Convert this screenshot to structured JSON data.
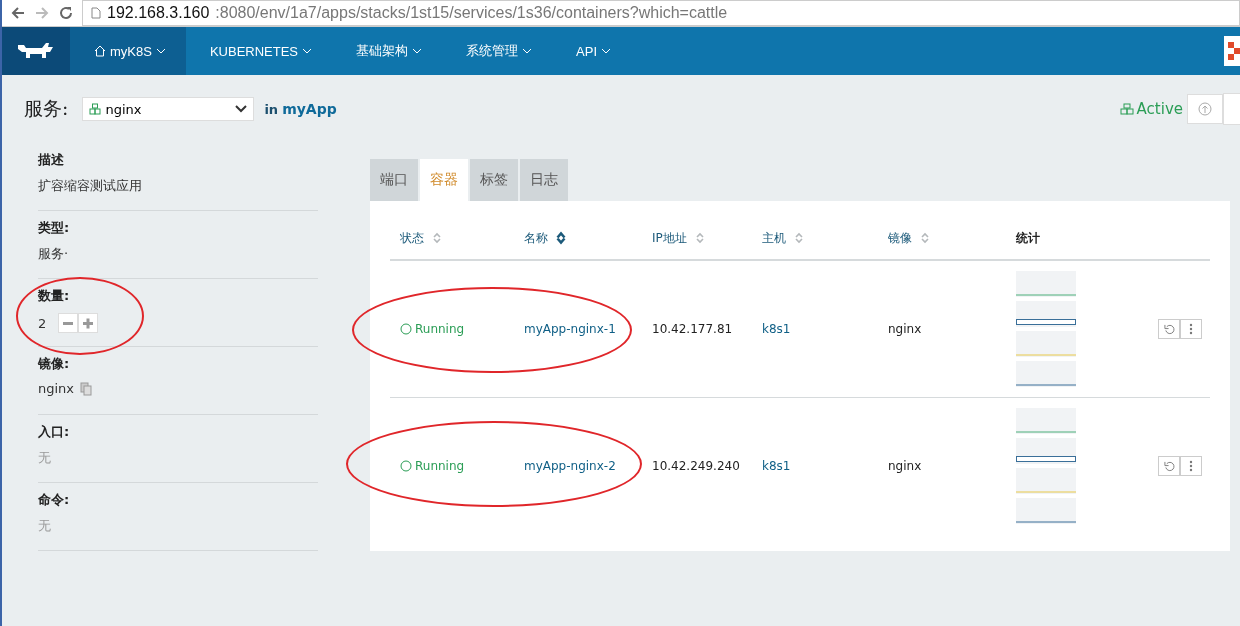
{
  "browser": {
    "url_host": "192.168.3.160",
    "url_rest": ":8080/env/1a7/apps/stacks/1st15/services/1s36/containers?which=cattle"
  },
  "nav": [
    {
      "label": "myK8S",
      "kind": "home",
      "selected": true
    },
    {
      "label": "KUBERNETES",
      "kind": "menu",
      "selected": false
    },
    {
      "label": "基础架构",
      "kind": "menu",
      "selected": false
    },
    {
      "label": "系统管理",
      "kind": "menu",
      "selected": false
    },
    {
      "label": "API",
      "kind": "menu",
      "selected": false
    }
  ],
  "header": {
    "title": "服务:",
    "service": "nginx",
    "in_label": "in",
    "stack": "myApp",
    "state": "Active"
  },
  "details": [
    {
      "label": "描述",
      "value": "扩容缩容测试应用",
      "kind": "text",
      "muted": false
    },
    {
      "label": "类型:",
      "value": "服务·",
      "kind": "text",
      "muted": false
    },
    {
      "label": "数量:",
      "value": "2",
      "kind": "scale",
      "muted": false
    },
    {
      "label": "镜像:",
      "value": "nginx",
      "kind": "copy",
      "muted": false
    },
    {
      "label": "入口:",
      "value": "无",
      "kind": "text",
      "muted": true
    },
    {
      "label": "命令:",
      "value": "无",
      "kind": "text",
      "muted": true
    }
  ],
  "tabs": [
    {
      "label": "端口",
      "selected": false
    },
    {
      "label": "容器",
      "selected": true
    },
    {
      "label": "标签",
      "selected": false
    },
    {
      "label": "日志",
      "selected": false
    }
  ],
  "table": {
    "columns": [
      {
        "label": "状态",
        "sortable": true,
        "sorted": false
      },
      {
        "label": "名称",
        "sortable": true,
        "sorted": true
      },
      {
        "label": "IP地址",
        "sortable": true,
        "sorted": false
      },
      {
        "label": "主机",
        "sortable": true,
        "sorted": false
      },
      {
        "label": "镜像",
        "sortable": true,
        "sorted": false
      },
      {
        "label": "统计",
        "sortable": false,
        "sorted": false
      }
    ],
    "rows": [
      {
        "state": "Running",
        "name": "myApp-nginx-1",
        "ip": "10.42.177.81",
        "host": "k8s1",
        "image": "nginx"
      },
      {
        "state": "Running",
        "name": "myApp-nginx-2",
        "ip": "10.42.249.240",
        "host": "k8s1",
        "image": "nginx"
      }
    ]
  }
}
